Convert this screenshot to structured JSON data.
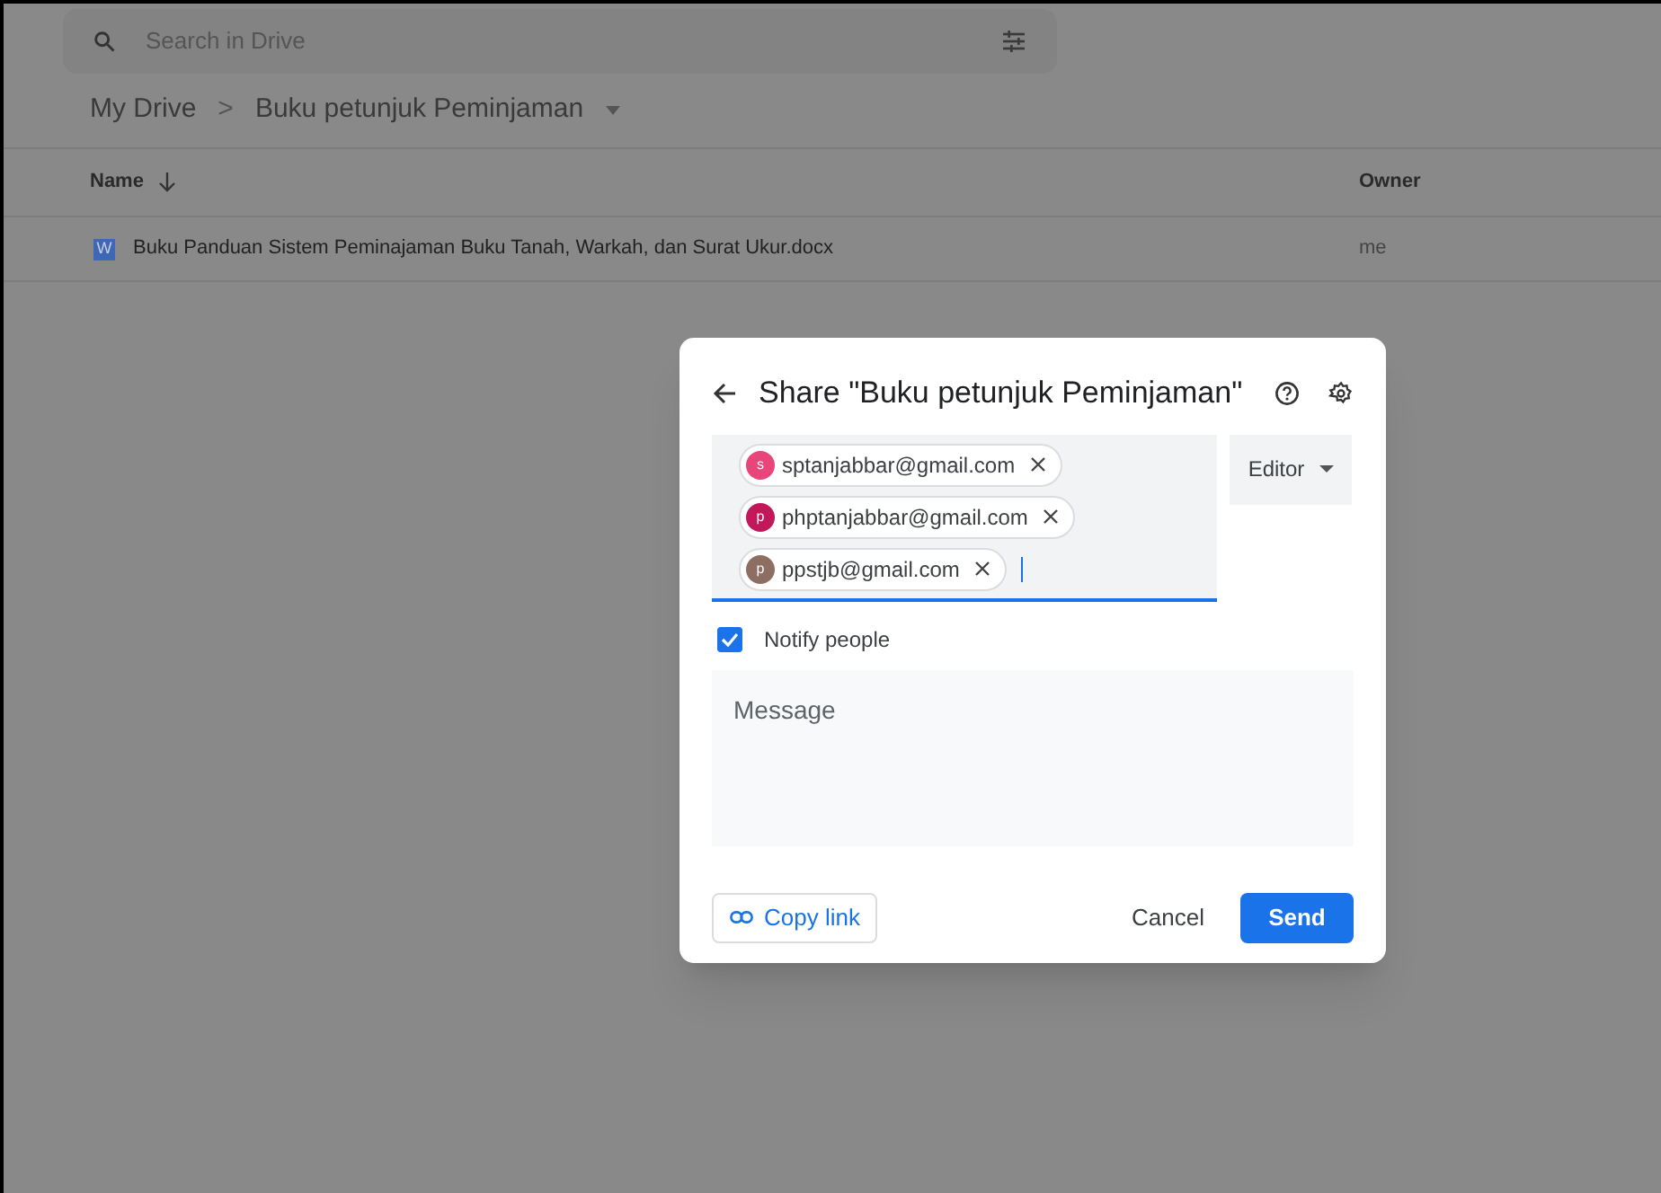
{
  "search": {
    "placeholder": "Search in Drive"
  },
  "breadcrumb": {
    "items": [
      "My Drive",
      "Buku petunjuk Peminjaman"
    ],
    "separator": ">"
  },
  "table": {
    "columns": [
      "Name",
      "Owner"
    ],
    "rows": [
      {
        "name": "Buku Panduan Sistem Peminajaman Buku Tanah, Warkah, dan Surat Ukur.docx",
        "owner": "me",
        "file_badge": "W"
      }
    ]
  },
  "dialog": {
    "title": "Share \"Buku petunjuk Peminjaman\"",
    "recipients": [
      {
        "initial": "s",
        "email": "sptanjabbar@gmail.com",
        "color": "#e8457a"
      },
      {
        "initial": "p",
        "email": "phptanjabbar@gmail.com",
        "color": "#c2185b"
      },
      {
        "initial": "p",
        "email": "ppstjb@gmail.com",
        "color": "#8d6e63"
      }
    ],
    "role": "Editor",
    "notify": {
      "label": "Notify people",
      "checked": true
    },
    "message": {
      "placeholder": "Message"
    },
    "copy_link": "Copy link",
    "cancel": "Cancel",
    "send": "Send"
  }
}
